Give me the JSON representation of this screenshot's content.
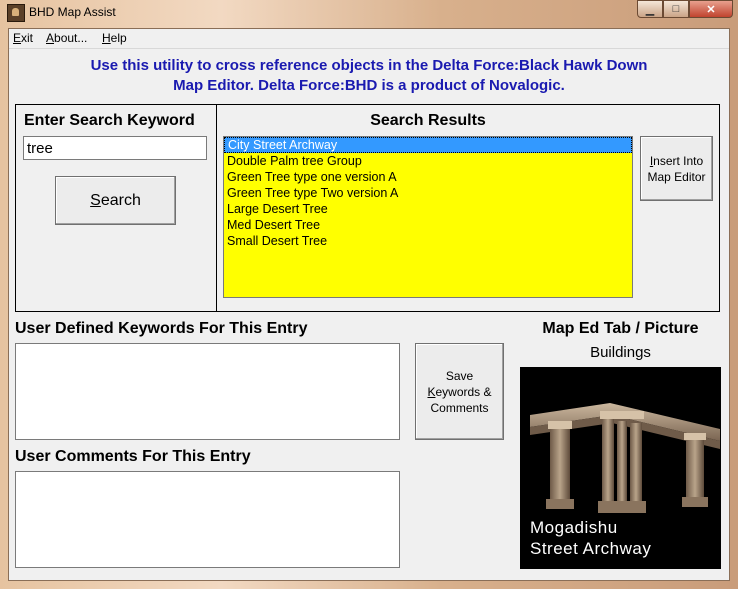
{
  "window": {
    "title": "BHD Map Assist"
  },
  "caption": {
    "minimize": "▁",
    "maximize": "□",
    "close": "✕"
  },
  "menu": {
    "exit": {
      "accel": "E",
      "rest": "xit"
    },
    "about": {
      "accel": "A",
      "rest": "bout..."
    },
    "help": {
      "accel": "H",
      "rest": "elp"
    }
  },
  "intro": {
    "line1": "Use this utility to cross reference objects in the Delta Force:Black Hawk Down",
    "line2": "Map Editor.  Delta Force:BHD is a product of Novalogic."
  },
  "search": {
    "heading": "Enter Search Keyword",
    "value": "tree",
    "button": {
      "accel": "S",
      "rest": "earch"
    }
  },
  "results": {
    "heading": "Search Results",
    "selected_index": 0,
    "items": [
      "City Street Archway",
      "Double Palm tree Group",
      "Green Tree type one version A",
      "Green Tree type Two version A",
      "Large Desert Tree",
      "Med Desert Tree",
      "Small Desert Tree"
    ],
    "insert_button": {
      "accel": "I",
      "rest1": "nsert Into",
      "line2": "Map Editor"
    }
  },
  "keywords": {
    "heading": "User Defined Keywords For This Entry",
    "value": ""
  },
  "comments": {
    "heading": "User Comments For This Entry",
    "value": ""
  },
  "save_button": {
    "line1": "Save",
    "accel": "K",
    "rest2": "eywords &",
    "line3": "Comments"
  },
  "preview": {
    "heading": "Map Ed Tab / Picture",
    "category": "Buildings",
    "caption_line1": "Mogadishu",
    "caption_line2": "Street Archway"
  },
  "colors": {
    "intro_text": "#1a1ab0",
    "results_bg": "#ffff00",
    "selection": "#3399ff"
  }
}
